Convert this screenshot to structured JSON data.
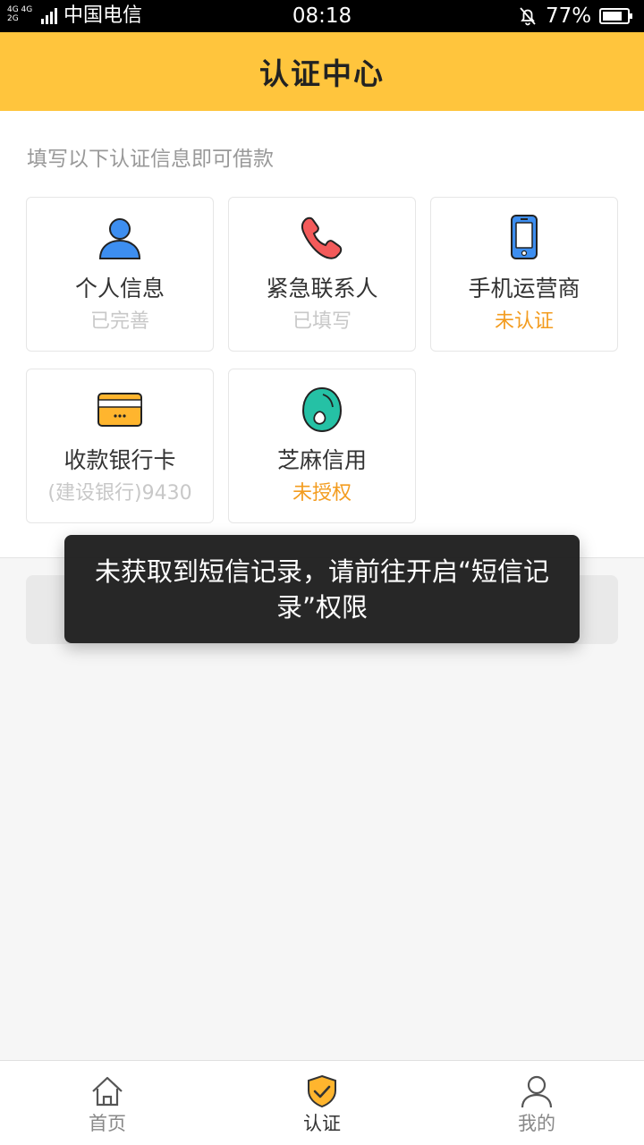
{
  "statusbar": {
    "net_top": "4G 4G",
    "net_bottom": "2G",
    "carrier": "中国电信",
    "time": "08:18",
    "battery": "77%"
  },
  "header": {
    "title": "认证中心"
  },
  "hint": "填写以下认证信息即可借款",
  "cards": [
    {
      "name": "个人信息",
      "status": "已完善",
      "icon": "person-icon"
    },
    {
      "name": "紧急联系人",
      "status": "已填写",
      "icon": "phone-icon"
    },
    {
      "name": "手机运营商",
      "status": "未认证",
      "icon": "mobile-icon"
    },
    {
      "name": "收款银行卡",
      "status": "(建设银行)9430",
      "icon": "bank-card-icon"
    },
    {
      "name": "芝麻信用",
      "status": "未授权",
      "icon": "sesame-credit-icon"
    }
  ],
  "toast": {
    "message": "未获取到短信记录，请前往开启“短信记录”权限"
  },
  "colors": {
    "accent": "#ffc53d",
    "warning": "#f39c1f",
    "muted": "#c8c8c8"
  },
  "nav": [
    {
      "label": "首页",
      "icon": "home-icon"
    },
    {
      "label": "认证",
      "icon": "shield-check-icon"
    },
    {
      "label": "我的",
      "icon": "user-icon"
    }
  ]
}
